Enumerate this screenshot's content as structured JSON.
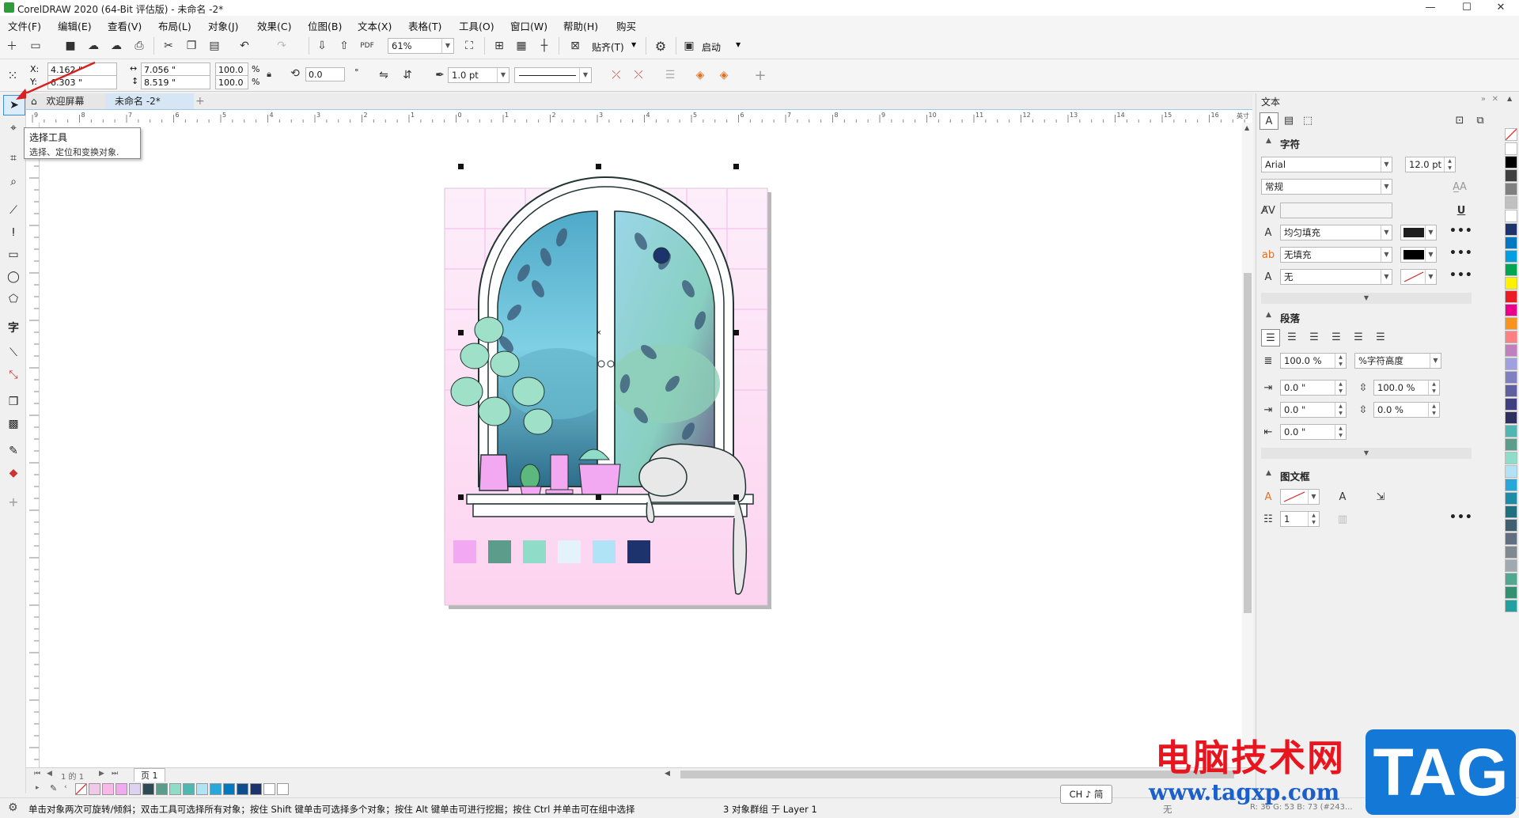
{
  "window": {
    "title": "CorelDRAW 2020 (64-Bit 评估版) - 未命名 -2*",
    "minimize": "—",
    "maximize": "☐",
    "close": "✕"
  },
  "menu": [
    "文件(F)",
    "编辑(E)",
    "查看(V)",
    "布局(L)",
    "对象(J)",
    "效果(C)",
    "位图(B)",
    "文本(X)",
    "表格(T)",
    "工具(O)",
    "窗口(W)",
    "帮助(H)",
    "购买"
  ],
  "toolbar": {
    "zoom": "61%",
    "snap_label": "贴齐(T)",
    "launch_label": "启动"
  },
  "propbar": {
    "x_label": "X:",
    "x": "4.162 \"",
    "y_label": "Y:",
    "y": "6.303 \"",
    "w": "7.056 \"",
    "h": "8.519 \"",
    "scale_w": "100.0",
    "scale_h": "100.0",
    "pct": "%",
    "rotation": "0.0",
    "deg": "°",
    "outline": "1.0 pt"
  },
  "tabs": {
    "welcome": "欢迎屏幕",
    "document": "未命名 -2*",
    "add": "+"
  },
  "tooltip": {
    "title": "选择工具",
    "desc": "选择、定位和变换对象."
  },
  "ruler": {
    "h_ticks": [
      "9",
      "8",
      "7",
      "6",
      "5",
      "4",
      "3",
      "2",
      "1",
      "0",
      "1",
      "2",
      "3",
      "4",
      "5",
      "6",
      "7",
      "8",
      "9",
      "10",
      "11",
      "12",
      "13",
      "14",
      "15",
      "16"
    ],
    "unit": "英寸"
  },
  "pagenav": {
    "info": "1 的 1",
    "page_tab": "页 1"
  },
  "artwork": {
    "swatches": [
      "#f3a9f2",
      "#5b9c8a",
      "#8fdcc9",
      "#e4f3fb",
      "#b0e3f6",
      "#1c336e"
    ]
  },
  "doc_palette": [
    "#f0c8e8",
    "#f8b8e8",
    "#f3a9f2",
    "#ddd3f0",
    "#2d4b55",
    "#5b9c8a",
    "#8fdcc9",
    "#4fb6b0",
    "#b0e3f6",
    "#27a8d8",
    "#0079c0",
    "#0f4e8a",
    "#1c336e",
    "#ffffff",
    "#ffffff"
  ],
  "status": {
    "hint": "单击对象两次可旋转/倾斜；双击工具可选择所有对象；按住 Shift 键单击可选择多个对象；按住 Alt 键单击可进行挖掘；按住 Ctrl 并单击可在组中选择",
    "selection": "3 对象群组 于 Layer 1",
    "ime": "CH ♪ 简",
    "fill_none": "无",
    "color_info": "R: 36 G: 53 B: 73 (#243..."
  },
  "panel": {
    "title": "文本",
    "char_section": "字符",
    "font": "Arial",
    "font_size": "12.0 pt",
    "style": "常规",
    "fill_type": "均匀填充",
    "bg_fill": "无填充",
    "outline": "无",
    "para_section": "段落",
    "line_spacing": "100.0 %",
    "spacing_unit": "%字符高度",
    "indent_left": "0.0 \"",
    "indent_first": "0.0 \"",
    "indent_right": "0.0 \"",
    "char_spacing": "100.0 %",
    "word_spacing": "0.0 %",
    "frame_section": "图文框",
    "columns": "1"
  },
  "color_palette": [
    "#ffffff",
    "#000000",
    "#404040",
    "#808080",
    "#c0c0c0",
    "#ffffff",
    "#1c336e",
    "#0079c0",
    "#00a0e0",
    "#00a651",
    "#fff200",
    "#ed1c24",
    "#ec008c",
    "#f7941d",
    "#ff8080",
    "#c080c0",
    "#a0a0e0",
    "#8080c0",
    "#6060a0",
    "#404080",
    "#303060",
    "#4fb6b0",
    "#5b9c8a",
    "#8fdcc9",
    "#b0e3f6",
    "#27a8d8",
    "#1c8ca8",
    "#207080",
    "#406070",
    "#607080",
    "#808890",
    "#a0a8b0",
    "#50a890",
    "#309070",
    "#20a0a0"
  ],
  "watermark": {
    "cn": "电脑技术网",
    "url": "www.tagxp.com",
    "tag": "TAG"
  }
}
